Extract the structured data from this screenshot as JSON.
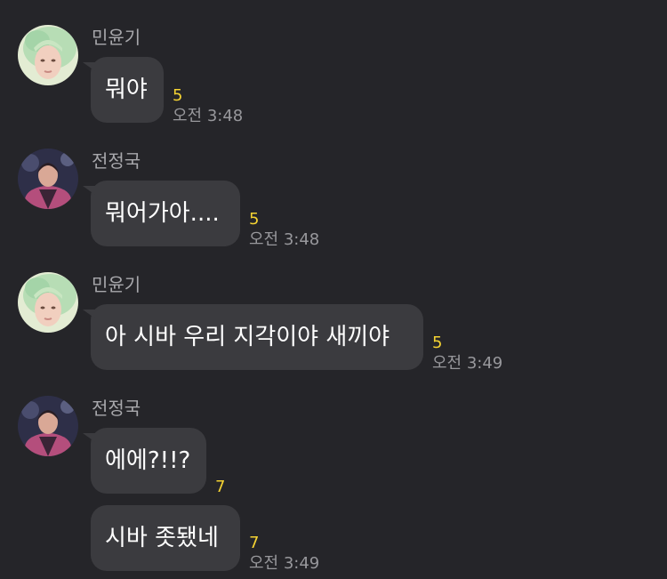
{
  "messages": [
    {
      "sender": "민윤기",
      "text": "뭐야",
      "unread": "5",
      "time": "오전 3:48"
    },
    {
      "sender": "전정국",
      "text": "뭐어가아....",
      "unread": "5",
      "time": "오전 3:48"
    },
    {
      "sender": "민윤기",
      "text": "아 시바 우리 지각이야 새끼야",
      "unread": "5",
      "time": "오전 3:49"
    },
    {
      "sender": "전정국",
      "texts": [
        "에에?!!?",
        "시바 좃됐네"
      ],
      "unread": [
        "7",
        "7"
      ],
      "time": "오전 3:49"
    }
  ],
  "colors": {
    "background": "#252529",
    "bubble": "#3b3b3f",
    "unread": "#f5d332",
    "sender": "#a8a8ac",
    "time": "#98989c"
  }
}
